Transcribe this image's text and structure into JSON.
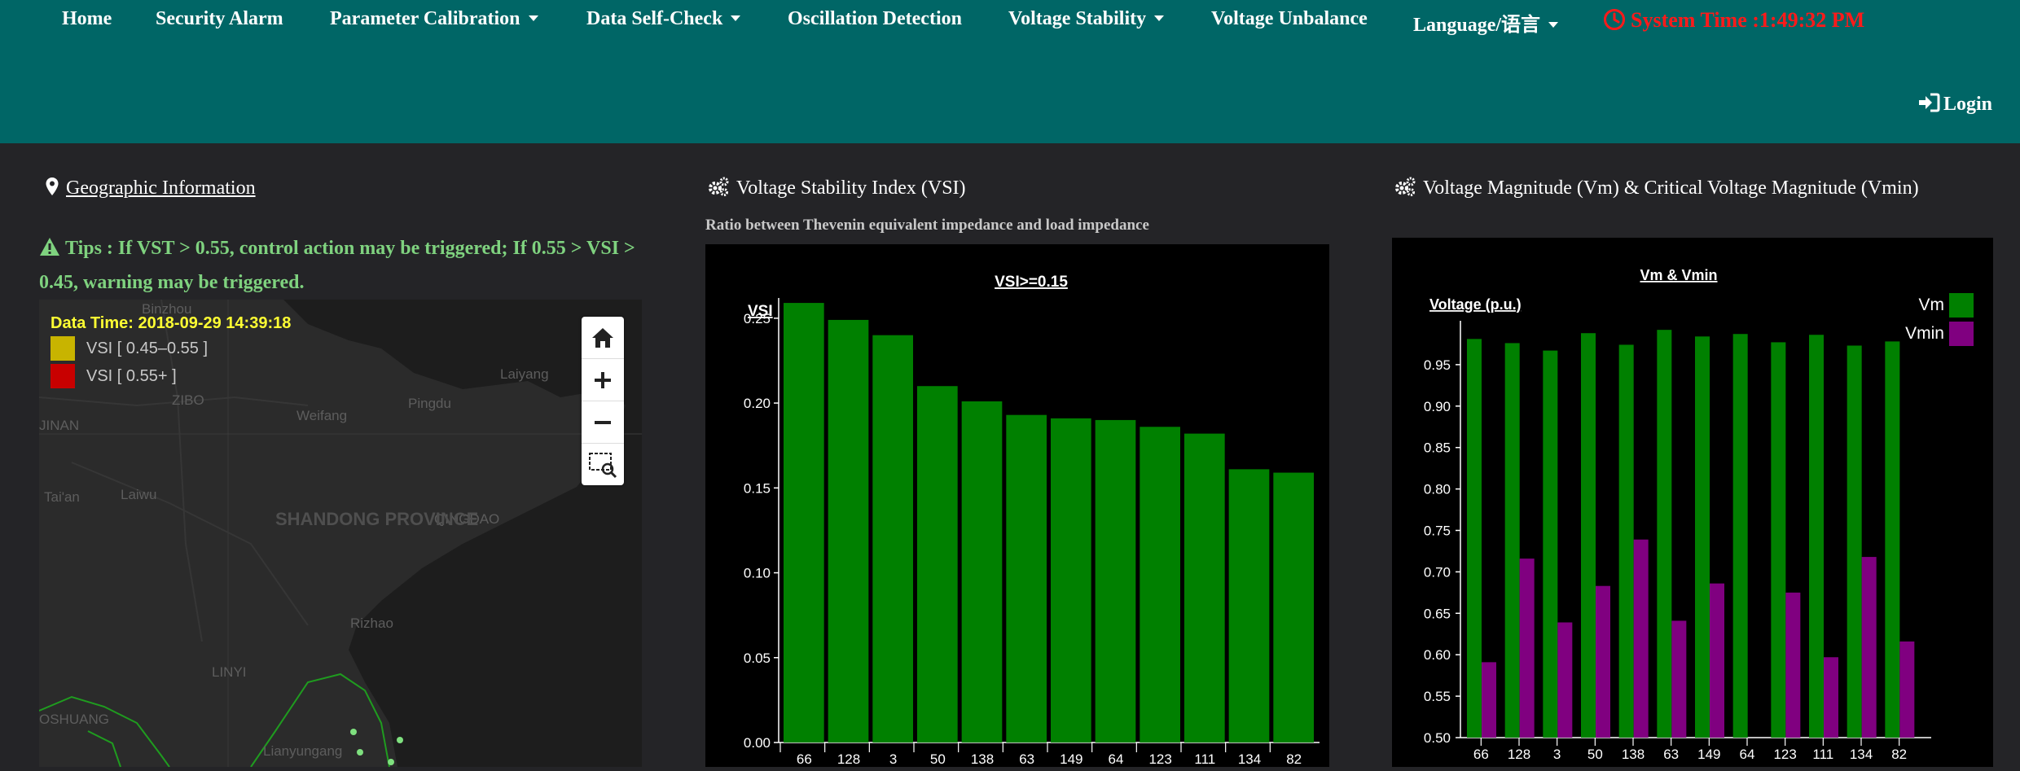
{
  "nav": {
    "items": [
      {
        "label": "Home",
        "dropdown": false
      },
      {
        "label": "Security Alarm",
        "dropdown": false
      },
      {
        "label": "Parameter Calibration",
        "dropdown": true
      },
      {
        "label": "Data Self-Check",
        "dropdown": true
      },
      {
        "label": "Oscillation Detection",
        "dropdown": false
      },
      {
        "label": "Voltage Stability",
        "dropdown": true
      },
      {
        "label": "Voltage Unbalance",
        "dropdown": false
      },
      {
        "label": "Language/语言",
        "dropdown": true
      }
    ],
    "system_time": "System Time :1:49:32 PM",
    "login_label": "Login"
  },
  "geo": {
    "title": "Geographic Information",
    "tips": "Tips : If VST > 0.55, control action may be triggered; If 0.55 > VSI > 0.45, warning may be triggered.",
    "data_time": "Data Time: 2018-09-29 14:39:18",
    "legend": [
      {
        "label": "VSI [ 0.45–0.55 ]",
        "color": "#c8b400"
      },
      {
        "label": "VSI [ 0.55+ ]",
        "color": "#c80000"
      }
    ],
    "map_labels": {
      "binzhou": "Binzhou",
      "laiyang": "Laiyang",
      "zibo": "ZIBO",
      "weifang": "Weifang",
      "pingdu": "Pingdu",
      "jinan": "JINAN",
      "taian": "Tai'an",
      "laiwu": "Laiwu",
      "qingdao": "QINGDAO",
      "shandong": "SHANDONG PROVINCE",
      "rizhao": "Rizhao",
      "linyi": "LINYI",
      "lianyungang": "Lianyungang",
      "xuzhou": "OSHUANG"
    },
    "controls": [
      "home-icon",
      "zoom-in-icon",
      "zoom-out-icon",
      "zoom-box-icon"
    ]
  },
  "vsi_panel": {
    "title": "Voltage Stability Index (VSI)",
    "subtitle": "Ratio between Thevenin equivalent impedance and load impedance"
  },
  "vm_panel": {
    "title": "Voltage Magnitude (Vm) & Critical Voltage Magnitude (Vmin)"
  },
  "chart_data": [
    {
      "type": "bar",
      "title": "VSI>=0.15",
      "ylabel": "VSI",
      "xlabel": "",
      "categories": [
        "66",
        "128",
        "3",
        "50",
        "138",
        "63",
        "149",
        "64",
        "123",
        "111",
        "134",
        "82"
      ],
      "values": [
        0.259,
        0.249,
        0.24,
        0.21,
        0.201,
        0.193,
        0.191,
        0.19,
        0.186,
        0.182,
        0.161,
        0.159
      ],
      "ylim": [
        0,
        0.26
      ],
      "yticks": [
        "0.00",
        "0.05",
        "0.10",
        "0.15",
        "0.20",
        "0.25"
      ],
      "color": "#008000",
      "grid": false
    },
    {
      "type": "bar",
      "title": "Vm & Vmin",
      "ylabel": "Voltage (p.u.)",
      "xlabel": "",
      "categories": [
        "66",
        "128",
        "3",
        "50",
        "138",
        "63",
        "149",
        "64",
        "123",
        "111",
        "134",
        "82"
      ],
      "series": [
        {
          "name": "Vm",
          "color": "#008000",
          "values": [
            0.981,
            0.976,
            0.967,
            0.988,
            0.974,
            0.992,
            0.984,
            0.987,
            0.977,
            0.986,
            0.973,
            0.978
          ]
        },
        {
          "name": "Vmin",
          "color": "#800080",
          "values": [
            0.591,
            0.716,
            0.639,
            0.683,
            0.739,
            0.641,
            0.686,
            0.5,
            0.675,
            0.597,
            0.718,
            0.616
          ]
        }
      ],
      "ylim": [
        0.5,
        1.0
      ],
      "yticks": [
        "0.50",
        "0.55",
        "0.60",
        "0.65",
        "0.70",
        "0.75",
        "0.80",
        "0.85",
        "0.90",
        "0.95"
      ],
      "legend": "top-right",
      "grid": false
    }
  ]
}
